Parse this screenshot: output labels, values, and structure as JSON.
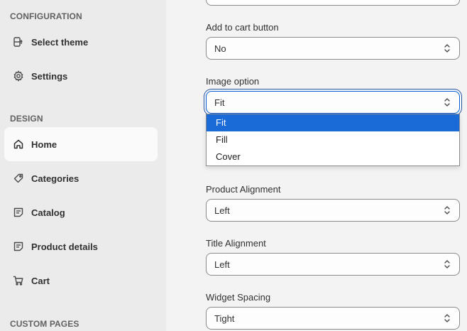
{
  "sidebar": {
    "sections": [
      {
        "title": "CONFIGURATION"
      },
      {
        "title": "DESIGN"
      },
      {
        "title": "CUSTOM PAGES"
      }
    ],
    "items": [
      {
        "label": "Select theme",
        "icon": "theme-icon"
      },
      {
        "label": "Settings",
        "icon": "gear-icon"
      },
      {
        "label": "Home",
        "icon": "home-icon",
        "active": true
      },
      {
        "label": "Categories",
        "icon": "tag-icon"
      },
      {
        "label": "Catalog",
        "icon": "catalog-icon"
      },
      {
        "label": "Product details",
        "icon": "product-details-icon"
      },
      {
        "label": "Cart",
        "icon": "cart-icon"
      }
    ]
  },
  "form": {
    "add_to_cart": {
      "label": "Add to cart button",
      "value": "No"
    },
    "image_option": {
      "label": "Image option",
      "value": "Fit",
      "options": [
        "Fit",
        "Fill",
        "Cover"
      ]
    },
    "product_alignment": {
      "label": "Product Alignment",
      "value": "Left"
    },
    "title_alignment": {
      "label": "Title Alignment",
      "value": "Left"
    },
    "widget_spacing": {
      "label": "Widget Spacing",
      "value": "Tight"
    }
  },
  "colors": {
    "focus_border": "#005bd3",
    "selected_option": "#1a6bd8",
    "sidebar_bg": "#ebebeb",
    "main_bg": "#f3f3f3"
  }
}
